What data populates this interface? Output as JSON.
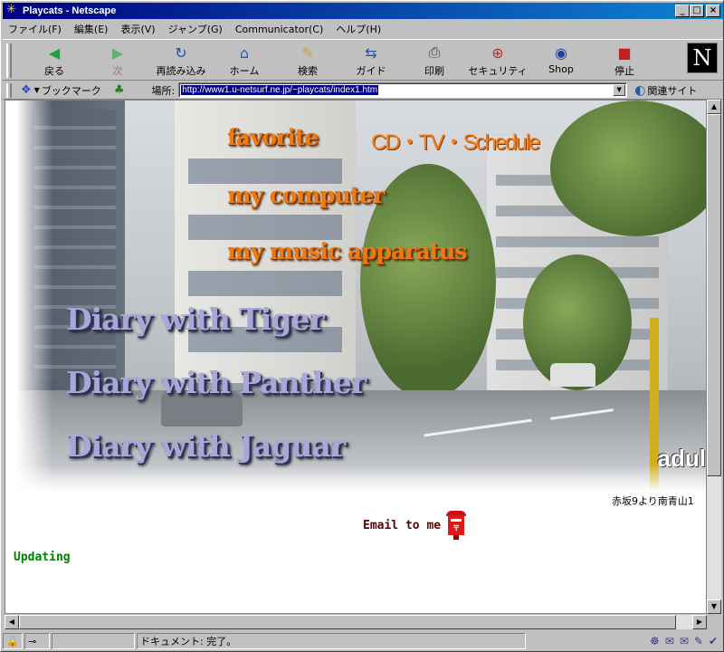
{
  "window": {
    "title": "Playcats - Netscape",
    "minimize": "_",
    "maximize": "□",
    "close": "×"
  },
  "menu": [
    "ファイル(F)",
    "編集(E)",
    "表示(V)",
    "ジャンプ(G)",
    "Communicator(C)",
    "ヘルプ(H)"
  ],
  "toolbar": [
    {
      "label": "戻る",
      "icon": "back-arrow-icon",
      "glyph": "◀",
      "color": "#20a040",
      "enabled": true
    },
    {
      "label": "次",
      "icon": "forward-arrow-icon",
      "glyph": "▶",
      "color": "#60b070",
      "enabled": false
    },
    {
      "label": "再読み込み",
      "icon": "reload-icon",
      "glyph": "↻",
      "color": "#2050a0",
      "enabled": true
    },
    {
      "label": "ホーム",
      "icon": "home-icon",
      "glyph": "⌂",
      "color": "#2060b0",
      "enabled": true
    },
    {
      "label": "検索",
      "icon": "search-icon",
      "glyph": "✎",
      "color": "#d0a020",
      "enabled": true
    },
    {
      "label": "ガイド",
      "icon": "guide-icon",
      "glyph": "⇆",
      "color": "#3050a0",
      "enabled": true
    },
    {
      "label": "印刷",
      "icon": "print-icon",
      "glyph": "⎙",
      "color": "#404040",
      "enabled": true
    },
    {
      "label": "セキュリティ",
      "icon": "lock-icon",
      "glyph": "🔒",
      "color": "#b03030",
      "enabled": true
    },
    {
      "label": "Shop",
      "icon": "shop-icon",
      "glyph": "◉",
      "color": "#2040a0",
      "enabled": true
    },
    {
      "label": "停止",
      "icon": "stop-icon",
      "glyph": "■",
      "color": "#c02020",
      "enabled": true
    }
  ],
  "brand_logo": "N",
  "location": {
    "bookmarks_label": "ブックマーク",
    "location_label": "場所:",
    "url": "http://www1.u-netsurf.ne.jp/~playcats/index1.htm",
    "related_label": "関連サイト"
  },
  "page": {
    "links_orange": {
      "favorite": "favorite",
      "cd_tv": "CD・TV・Schedule",
      "computer": "my computer",
      "music": "my music apparatus"
    },
    "diary_links": [
      "Diary with Tiger",
      "Diary with Panther",
      "Diary with Jaguar"
    ],
    "corner_text": "adul",
    "caption": "赤坂9より南青山1",
    "email_label": "Email to me",
    "updating_label": "Updating"
  },
  "status": {
    "text": "ドキュメント: 完了。"
  },
  "colors": {
    "title_bar": "#000080",
    "orange_link": "#f07a10",
    "diary_link": "#a8a8d8",
    "updating": "#008000",
    "email": "#600000"
  }
}
